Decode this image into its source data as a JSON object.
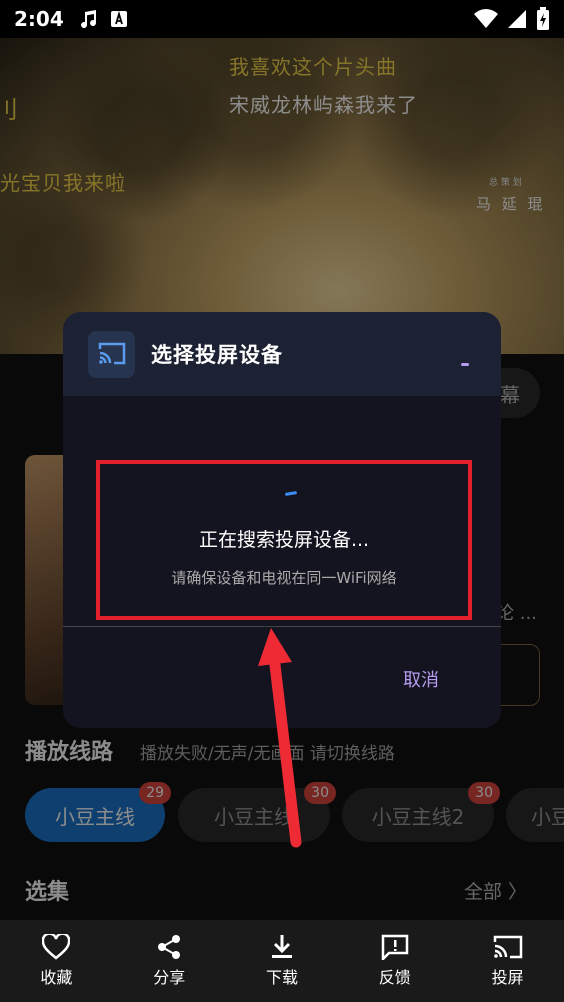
{
  "status_bar": {
    "time": "2:04"
  },
  "video": {
    "lyrics": [
      "我喜欢这个片头曲",
      "宋威龙林屿森我来了",
      "光宝贝我来啦",
      "刂"
    ],
    "credit_title": "总 策 划",
    "credit_name": "马 延 琨"
  },
  "danmu_label": "幕",
  "info_text": "论 ...",
  "route": {
    "title": "播放线路",
    "hint": "播放失败/无声/无画面 请切换线路",
    "chips": [
      {
        "label": "小豆主线",
        "badge": "29"
      },
      {
        "label": "小豆主线",
        "badge": "30"
      },
      {
        "label": "小豆主线2",
        "badge": "30"
      },
      {
        "label": "小豆",
        "badge": ""
      }
    ]
  },
  "episodes": {
    "title": "选集",
    "all_label": "全部 〉"
  },
  "dialog": {
    "title": "选择投屏设备",
    "searching": "正在搜索投屏设备...",
    "hint": "请确保设备和电视在同一WiFi网络",
    "cancel": "取消"
  },
  "bottom_nav": [
    "收藏",
    "分享",
    "下载",
    "反馈",
    "投屏"
  ],
  "colors": {
    "accent": "#b69cf0",
    "primary_blue": "#1a73c8",
    "highlight_red": "#e3212b"
  }
}
